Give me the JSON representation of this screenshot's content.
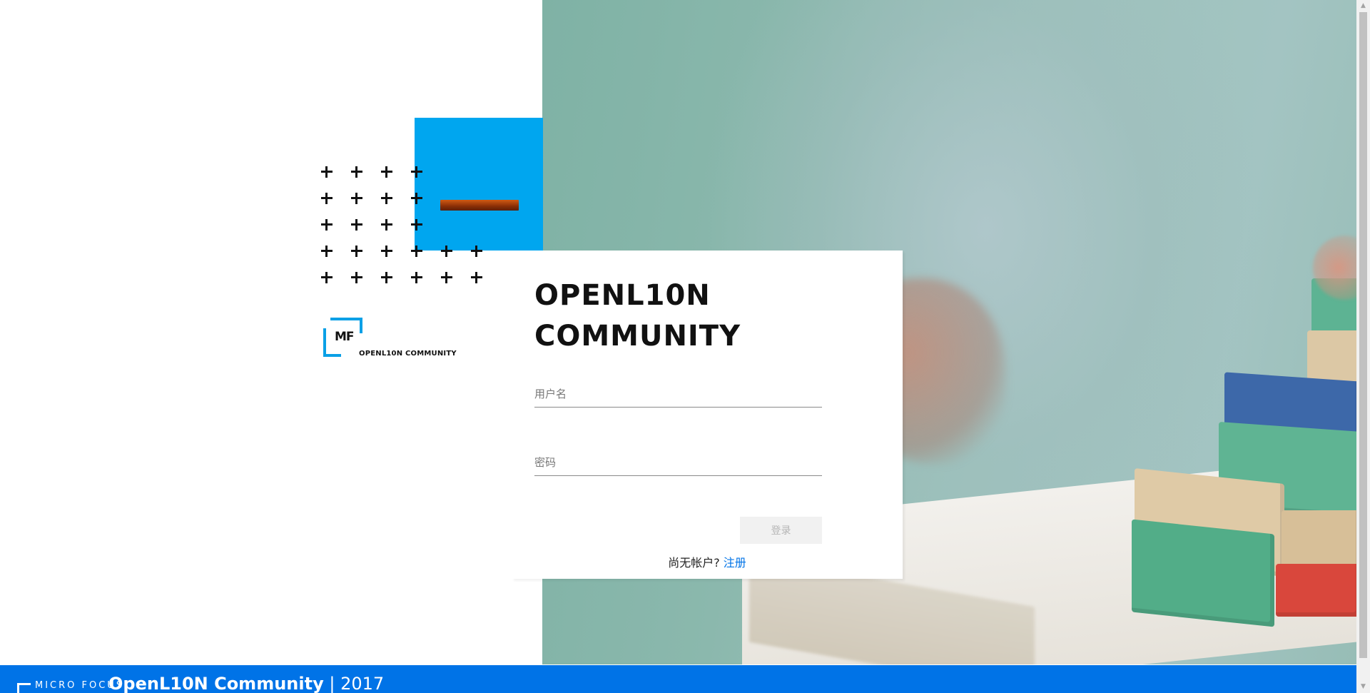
{
  "card": {
    "title": "OPENL10N\nCOMMUNITY",
    "username_placeholder": "用户名",
    "password_placeholder": "密码",
    "login_label": "登录",
    "no_account_text": "尚无帐户? ",
    "register_label": "注册"
  },
  "logo": {
    "mark_text": "MF",
    "caption": "OPENL10N COMMUNITY"
  },
  "footer": {
    "company_logo_text": "MICRO FOCUS",
    "product_name": "OpenL10N Community",
    "separator": " | ",
    "year": "2017"
  },
  "colors": {
    "accent_blue": "#00a6ef",
    "footer_blue": "#0073e7",
    "link_blue": "#0073e7",
    "title_text": "#111111"
  },
  "icons": {
    "decor_plus": "plus-icon",
    "scroll_up": "triangle-up",
    "scroll_down": "triangle-down"
  }
}
